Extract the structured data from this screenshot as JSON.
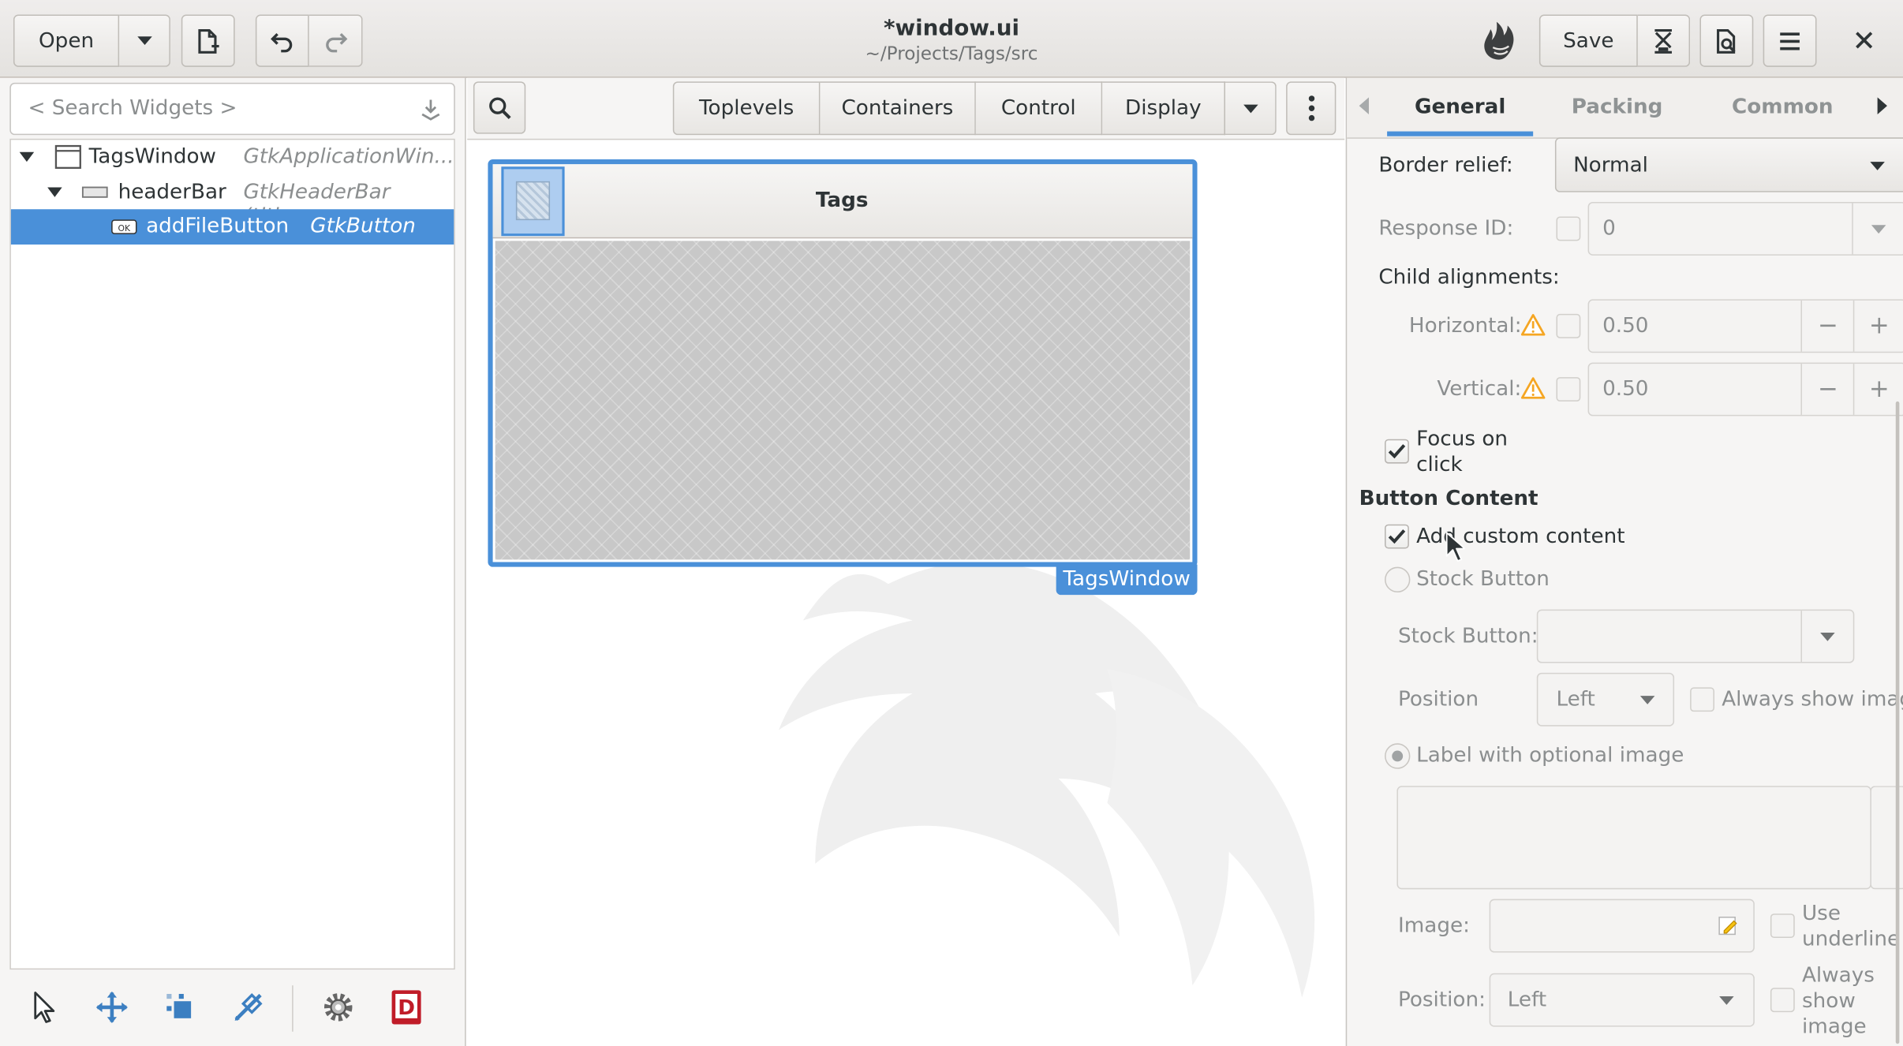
{
  "header": {
    "open_label": "Open",
    "title": "*window.ui",
    "subtitle": "~/Projects/Tags/src",
    "save_label": "Save"
  },
  "left": {
    "search_placeholder": "< Search Widgets >",
    "tree": [
      {
        "name": "TagsWindow",
        "type": "GtkApplicationWin..."
      },
      {
        "name": "headerBar",
        "type": "GtkHeaderBar (title..."
      },
      {
        "name": "addFileButton",
        "type": "GtkButton"
      }
    ],
    "bottom_tools": [
      "pointer-icon",
      "drag-resize-icon",
      "margin-edit-icon",
      "align-edit-icon",
      "gear-icon",
      "devhelp-icon"
    ]
  },
  "center": {
    "palette_tabs": [
      "Toplevels",
      "Containers",
      "Control",
      "Display"
    ],
    "preview_title": "Tags",
    "preview_caption": "TagsWindow"
  },
  "right": {
    "tabs": [
      "General",
      "Packing",
      "Common"
    ],
    "active_tab": "General",
    "border_relief_label": "Border relief:",
    "border_relief_value": "Normal",
    "response_id_label": "Response ID:",
    "response_id_value": "0",
    "child_alignments_label": "Child alignments:",
    "horizontal_label": "Horizontal:",
    "horizontal_value": "0.50",
    "vertical_label": "Vertical:",
    "vertical_value": "0.50",
    "focus_on_click_line1": "Focus on",
    "focus_on_click_line2": "click",
    "button_content_heading": "Button Content",
    "add_custom_content_label": "Add custom content",
    "stock_button_radio_label": "Stock Button",
    "stock_button_field_label": "Stock Button:",
    "position_label": "Position",
    "position_value": "Left",
    "always_show_image_label": "Always show imag",
    "label_optional_image": "Label with optional image",
    "image_label": "Image:",
    "use_underline_line1": "Use",
    "use_underline_line2": "underline",
    "position2_label": "Position:",
    "position2_value": "Left",
    "always_show2_line1": "Always",
    "always_show2_line2": "show",
    "always_show2_line3": "image"
  },
  "colors": {
    "selection": "#4a90d9",
    "accent_blue": "#4a90d9",
    "warning": "#f5a623"
  }
}
